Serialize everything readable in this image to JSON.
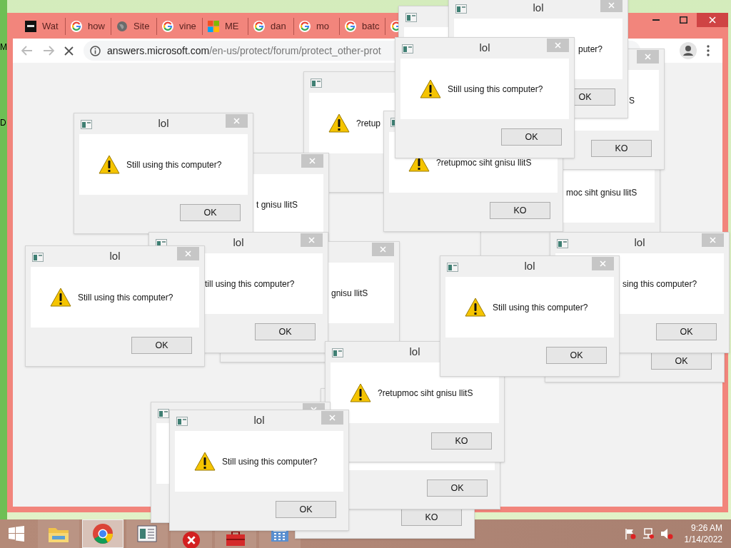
{
  "desktop": {
    "labels": [
      "M",
      "D"
    ]
  },
  "browser": {
    "tabs": [
      {
        "kind": "video",
        "label": "Wat"
      },
      {
        "kind": "google",
        "label": "how"
      },
      {
        "kind": "globe",
        "label": "Site"
      },
      {
        "kind": "google",
        "label": "vine"
      },
      {
        "kind": "microsoft",
        "label": "ME"
      },
      {
        "kind": "google",
        "label": "dan"
      },
      {
        "kind": "google",
        "label": "mo"
      },
      {
        "kind": "google",
        "label": "batc"
      },
      {
        "kind": "google"
      }
    ],
    "address": {
      "domain": "answers.microsoft.com",
      "path": "/en-us/protect/forum/protect_other-prot"
    }
  },
  "dialogs": [
    {
      "kind": "message_box",
      "title": "lol",
      "message": "puter?",
      "button": "OK"
    },
    {
      "kind": "message_box"
    },
    {
      "kind": "message_box",
      "title": "lol",
      "message": "Still using this computer?",
      "button": "OK"
    },
    {
      "kind": "message_box",
      "message": "?retup"
    },
    {
      "kind": "message_box",
      "message": "S",
      "button": "KO"
    },
    {
      "kind": "message_box",
      "title": "lol",
      "message": "Still using this computer?",
      "button": "OK"
    },
    {
      "kind": "message_box",
      "message": "?retupmoc siht gnisu llitS",
      "button": "KO"
    },
    {
      "kind": "message_box",
      "message": "moc siht gnisu llitS"
    },
    {
      "kind": "message_box",
      "message": "t gnisu llitS"
    },
    {
      "kind": "message_box",
      "title": "lol",
      "message": "Still using this computer?",
      "button": "OK"
    },
    {
      "kind": "message_box",
      "title": "lol",
      "message": "till using this computer?",
      "button": "OK"
    },
    {
      "kind": "message_box",
      "message": "gnisu llitS"
    },
    {
      "kind": "message_box",
      "title": "lol",
      "message": "Still using this computer?",
      "button": "OK"
    },
    {
      "kind": "message_box",
      "button": "OK"
    },
    {
      "kind": "message_box",
      "title": "lol",
      "message": "sing this computer?",
      "button": "OK"
    },
    {
      "kind": "message_box",
      "title": "lol",
      "message": "?retupmoc siht gnisu llitS",
      "button": "KO"
    },
    {
      "kind": "message_box"
    },
    {
      "kind": "message_box",
      "title": "lol",
      "message": "Still using this computer?",
      "button": "OK"
    },
    {
      "kind": "message_box",
      "button": "KO"
    },
    {
      "kind": "message_box",
      "button": "OK"
    }
  ],
  "taskbar": {
    "items": [
      {
        "kind": "folder",
        "selected": false
      },
      {
        "kind": "chrome",
        "selected": true
      },
      {
        "kind": "document",
        "selected": false
      },
      {
        "kind": "error",
        "selected": false
      },
      {
        "kind": "toolbox",
        "selected": false
      },
      {
        "kind": "calculator",
        "selected": false
      }
    ],
    "clock": {
      "time": "9:26 AM",
      "date": "1/14/2022"
    }
  }
}
